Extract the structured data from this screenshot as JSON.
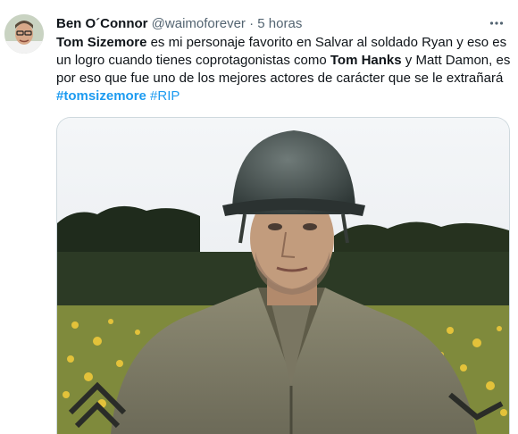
{
  "tweet": {
    "author_name": "Ben O´Connor",
    "handle": "@waimoforever",
    "separator": "·",
    "time": "5 horas",
    "text_parts": [
      {
        "t": "Tom Sizemore",
        "style": "bold"
      },
      {
        "t": " es mi personaje favorito en Salvar al soldado Ryan y eso es un logro cuando tienes coprotagonistas como ",
        "style": "plain"
      },
      {
        "t": "Tom Hanks",
        "style": "bold"
      },
      {
        "t": " y Matt Damon, es por eso que fue uno de los mejores actores de carácter que se le extrañará ",
        "style": "plain"
      },
      {
        "t": "#tomsizemore",
        "style": "hashtag-bold"
      },
      {
        "t": " ",
        "style": "plain"
      },
      {
        "t": "#RIP",
        "style": "hashtag"
      }
    ],
    "more_icon": "ellipsis-icon"
  },
  "colors": {
    "link": "#1d9bf0",
    "secondary_text": "#536471",
    "border": "#cfd9de"
  }
}
